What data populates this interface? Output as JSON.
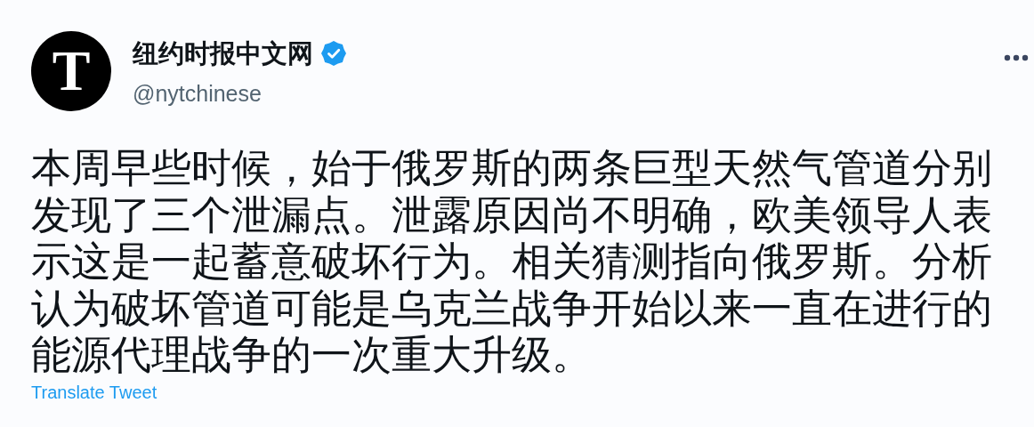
{
  "tweet": {
    "avatar_letter": "T",
    "display_name": "纽约时报中文网",
    "verified": true,
    "handle": "@nytchinese",
    "text": "本周早些时候，始于俄罗斯的两条巨型天然气管道分别发现了三个泄漏点。泄露原因尚不明确，欧美领导人表示这是一起蓄意破坏行为。相关猜测指向俄罗斯。分析认为破坏管道可能是乌克兰战争开始以来一直在进行的能源代理战争的一次重大升级。",
    "translate_link": "Translate Tweet"
  }
}
